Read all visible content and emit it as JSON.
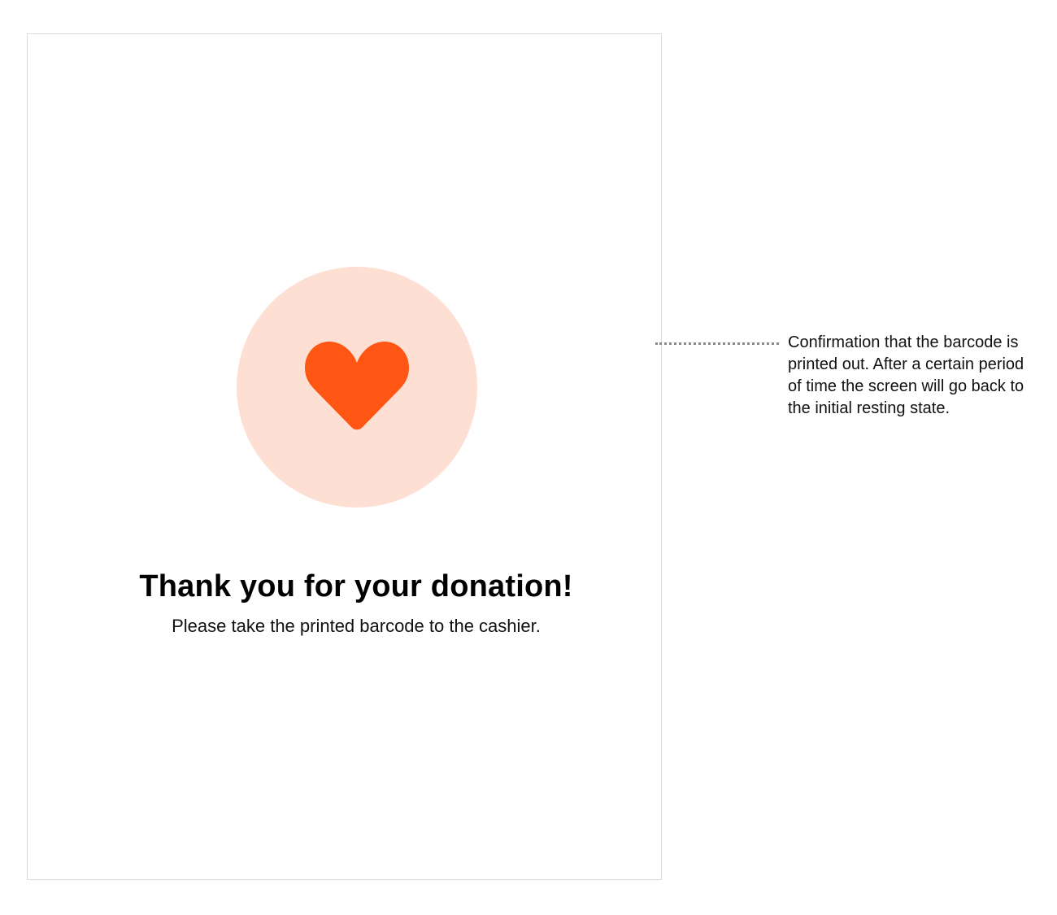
{
  "screen": {
    "title": "Thank you for your donation!",
    "subtitle": "Please take the printed barcode to the cashier.",
    "icon": "heart-icon"
  },
  "annotation": {
    "text": "Confirmation that the barcode is printed out. After a certain period of time the screen will go back to the initial resting state."
  },
  "colors": {
    "accent": "#ff5614",
    "accent_light": "#fedfd3",
    "frame_border": "#dcdcdc",
    "text": "#000000"
  }
}
